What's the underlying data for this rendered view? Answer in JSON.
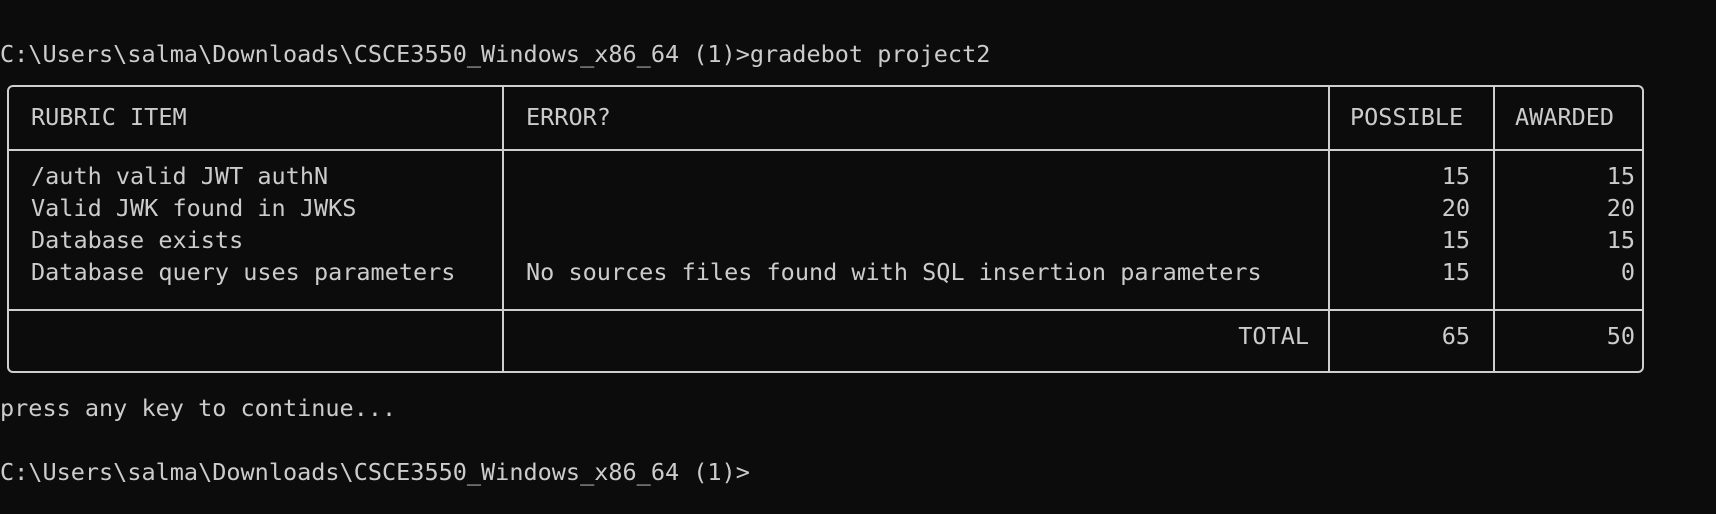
{
  "terminal": {
    "prompt_command": "C:\\Users\\salma\\Downloads\\CSCE3550_Windows_x86_64 (1)>gradebot project2",
    "continue_message": "press any key to continue...",
    "final_prompt": "C:\\Users\\salma\\Downloads\\CSCE3550_Windows_x86_64 (1)>"
  },
  "table": {
    "headers": {
      "item": "RUBRIC ITEM",
      "error": "ERROR?",
      "possible": "POSSIBLE",
      "awarded": "AWARDED"
    },
    "rows": [
      {
        "item": "/auth valid JWT authN",
        "error": "",
        "possible": "15",
        "awarded": "15"
      },
      {
        "item": "Valid JWK found in JWKS",
        "error": "",
        "possible": "20",
        "awarded": "20"
      },
      {
        "item": "Database exists",
        "error": "",
        "possible": "15",
        "awarded": "15"
      },
      {
        "item": "Database query uses parameters",
        "error": "No sources files found with SQL insertion parameters",
        "possible": "15",
        "awarded": "0"
      }
    ],
    "total": {
      "label": "TOTAL",
      "possible": "65",
      "awarded": "50"
    }
  },
  "colors": {
    "background": "#0c0c0c",
    "foreground": "#cccccc",
    "border": "#cfcfcf"
  }
}
